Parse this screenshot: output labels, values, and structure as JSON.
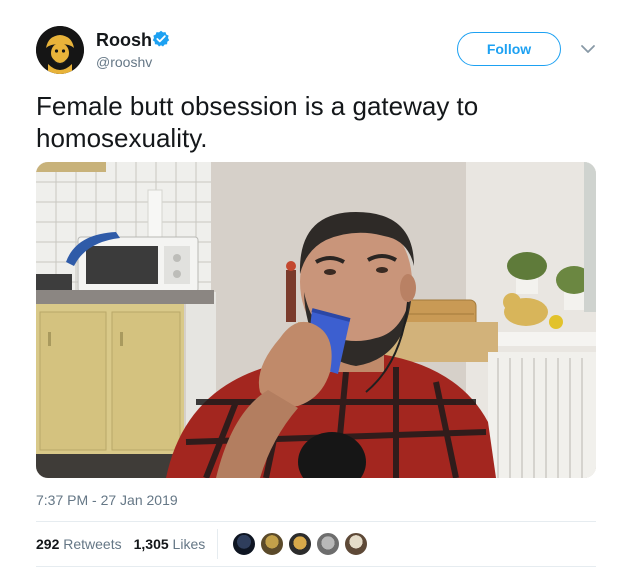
{
  "user": {
    "display_name": "Roosh",
    "handle": "@rooshv",
    "avatar_icon": "avatar-image",
    "verified_icon": "verified-badge-icon"
  },
  "follow_button": {
    "label": "Follow"
  },
  "menu_icon": "chevron-down-icon",
  "tweet": {
    "text": "Female butt obsession is a gateway to homosexuality.",
    "media_description": "video-thumbnail"
  },
  "timestamp": "7:37 PM - 27 Jan 2019",
  "stats": {
    "retweets_count": "292",
    "retweets_label": "Retweets",
    "likes_count": "1,305",
    "likes_label": "Likes"
  },
  "colors": {
    "accent": "#1da1f2",
    "secondary_text": "#657786",
    "primary_text": "#14171a",
    "divider": "#e6ecf0"
  }
}
